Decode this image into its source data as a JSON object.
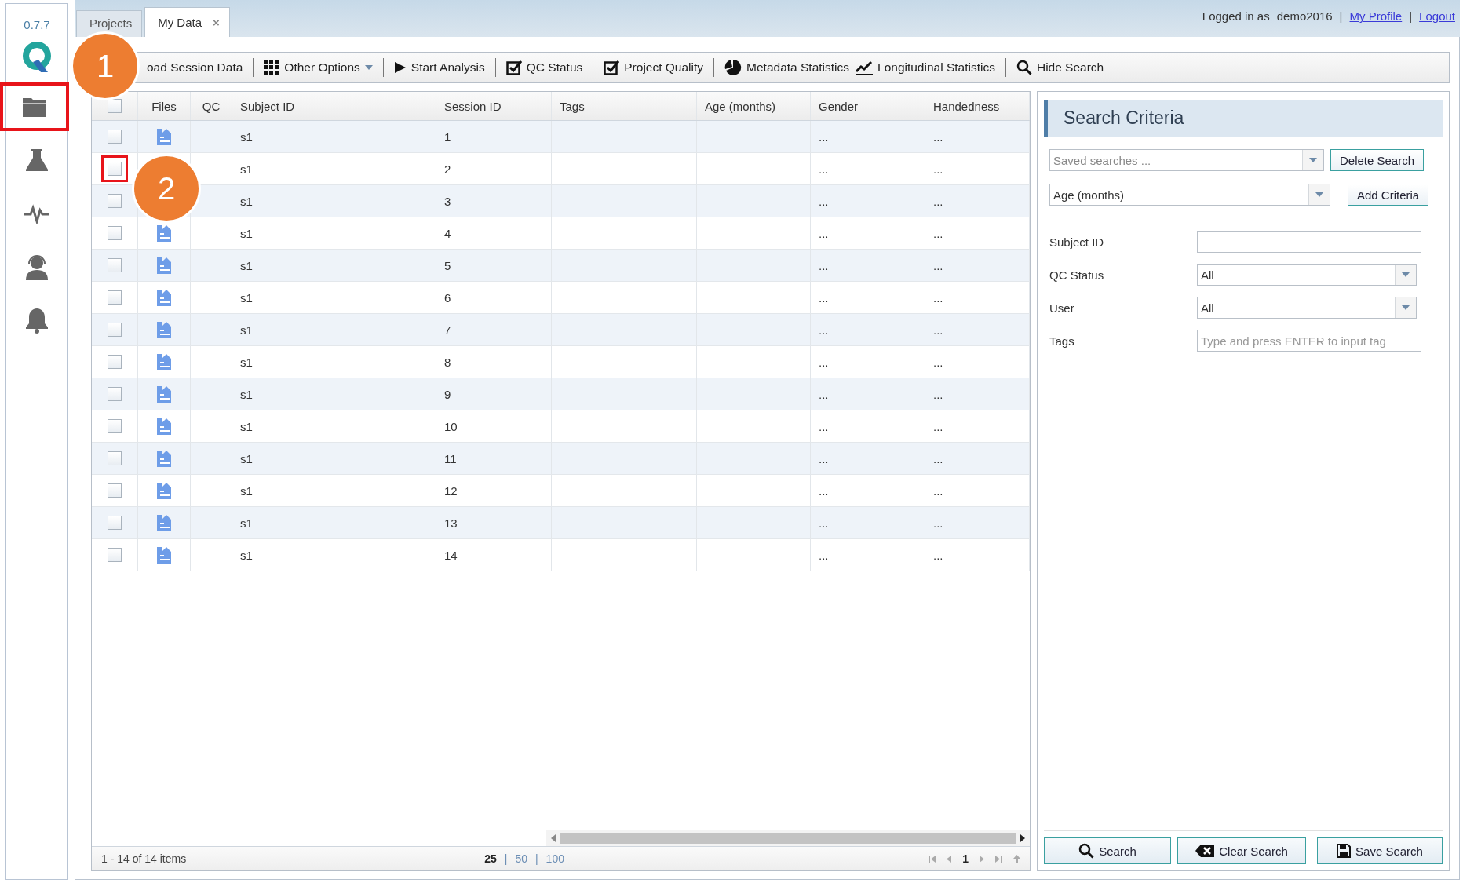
{
  "sidebar": {
    "version": "0.7.7",
    "items": [
      {
        "kind": "folder",
        "selected": true
      },
      {
        "kind": "flask",
        "selected": false
      },
      {
        "kind": "pulse",
        "selected": false
      },
      {
        "kind": "support",
        "selected": false
      },
      {
        "kind": "bell",
        "selected": false
      }
    ]
  },
  "tabs": [
    {
      "label": "Projects",
      "selected": false
    },
    {
      "label": "My Data",
      "selected": true,
      "close": "×"
    }
  ],
  "user_bar": [
    {
      "kind": "text",
      "text": "Logged in as"
    },
    {
      "kind": "name",
      "text": "demo2016"
    },
    {
      "kind": "sep",
      "text": "|"
    },
    {
      "kind": "link",
      "text": "My Profile"
    },
    {
      "kind": "sep",
      "text": "|"
    },
    {
      "kind": "link",
      "text": "Logout"
    }
  ],
  "toolbar": [
    {
      "label": "oad Session Data",
      "separator_before": false
    },
    {
      "label": "Other Options",
      "separator_before": true,
      "dropdown": true
    },
    {
      "label": "Start Analysis",
      "separator_before": true
    },
    {
      "label": "QC Status",
      "separator_before": true
    },
    {
      "label": "Project Quality",
      "separator_before": true
    },
    {
      "label": "Metadata Statistics",
      "separator_before": true
    },
    {
      "label": "Longitudinal Statistics",
      "separator_before": false
    },
    {
      "label": "Hide Search",
      "separator_before": true
    }
  ],
  "table": {
    "header_checked": false,
    "columns": [
      "Files",
      "QC",
      "Subject ID",
      "Session ID",
      "Tags",
      "Age (months)",
      "Gender",
      "Handedness"
    ],
    "rows": [
      {
        "checked": false,
        "highlighted": false,
        "file_icon": true,
        "subject_id": "s1",
        "session_id": "1",
        "gender": "...",
        "handedness": "..."
      },
      {
        "checked": false,
        "highlighted": true,
        "file_icon": false,
        "subject_id": "s1",
        "session_id": "2",
        "gender": "...",
        "handedness": "..."
      },
      {
        "checked": false,
        "highlighted": false,
        "file_icon": false,
        "subject_id": "s1",
        "session_id": "3",
        "gender": "...",
        "handedness": "..."
      },
      {
        "checked": false,
        "highlighted": false,
        "file_icon": true,
        "subject_id": "s1",
        "session_id": "4",
        "gender": "...",
        "handedness": "..."
      },
      {
        "checked": false,
        "highlighted": false,
        "file_icon": true,
        "subject_id": "s1",
        "session_id": "5",
        "gender": "...",
        "handedness": "..."
      },
      {
        "checked": false,
        "highlighted": false,
        "file_icon": true,
        "subject_id": "s1",
        "session_id": "6",
        "gender": "...",
        "handedness": "..."
      },
      {
        "checked": false,
        "highlighted": false,
        "file_icon": true,
        "subject_id": "s1",
        "session_id": "7",
        "gender": "...",
        "handedness": "..."
      },
      {
        "checked": false,
        "highlighted": false,
        "file_icon": true,
        "subject_id": "s1",
        "session_id": "8",
        "gender": "...",
        "handedness": "..."
      },
      {
        "checked": false,
        "highlighted": false,
        "file_icon": true,
        "subject_id": "s1",
        "session_id": "9",
        "gender": "...",
        "handedness": "..."
      },
      {
        "checked": false,
        "highlighted": false,
        "file_icon": true,
        "subject_id": "s1",
        "session_id": "10",
        "gender": "...",
        "handedness": "..."
      },
      {
        "checked": false,
        "highlighted": false,
        "file_icon": true,
        "subject_id": "s1",
        "session_id": "11",
        "gender": "...",
        "handedness": "..."
      },
      {
        "checked": false,
        "highlighted": false,
        "file_icon": true,
        "subject_id": "s1",
        "session_id": "12",
        "gender": "...",
        "handedness": "..."
      },
      {
        "checked": false,
        "highlighted": false,
        "file_icon": true,
        "subject_id": "s1",
        "session_id": "13",
        "gender": "...",
        "handedness": "..."
      },
      {
        "checked": false,
        "highlighted": false,
        "file_icon": true,
        "subject_id": "s1",
        "session_id": "14",
        "gender": "...",
        "handedness": "..."
      }
    ]
  },
  "pager": {
    "summary": "1 - 14 of 14 items",
    "page_sizes": [
      {
        "label": "25",
        "selected": true
      },
      {
        "separator": "|",
        "label": "50",
        "selected": false
      },
      {
        "separator": "|",
        "label": "100",
        "selected": false
      }
    ],
    "page": "1"
  },
  "search_panel": {
    "title": "Search Criteria",
    "saved_searches": {
      "placeholder": "Saved searches ..."
    },
    "delete_button": "Delete Search",
    "criteria_select": {
      "value": "Age (months)"
    },
    "add_button": "Add Criteria",
    "fields": [
      {
        "kind": "text",
        "label": "Subject ID"
      },
      {
        "kind": "select",
        "label": "QC Status",
        "value": "All"
      },
      {
        "kind": "select",
        "label": "User",
        "value": "All"
      },
      {
        "kind": "text",
        "label": "Tags",
        "placeholder": "Type and press ENTER to input tag"
      }
    ],
    "buttons": [
      "Search",
      "Clear Search",
      "Save Search"
    ]
  },
  "callouts": [
    "1",
    "2"
  ]
}
